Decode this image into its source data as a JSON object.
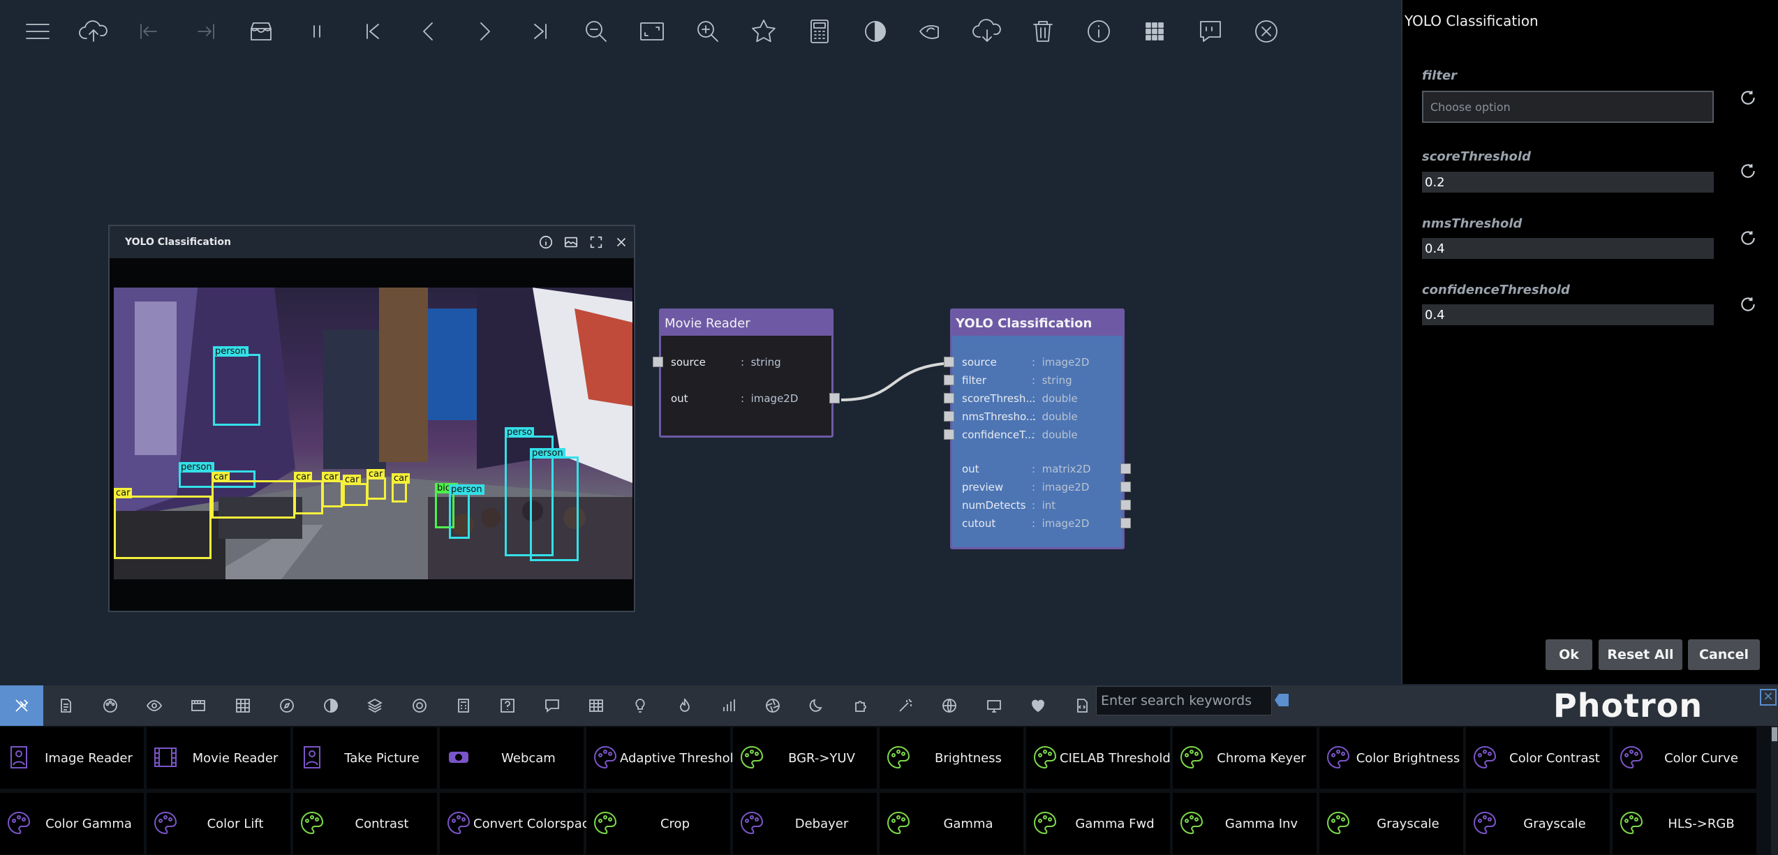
{
  "toolbar": [
    "menu-icon",
    "cloud-upload-icon",
    "step-back-icon",
    "step-forward-icon",
    "store-icon",
    "pause-icon",
    "skip-first-icon",
    "prev-icon",
    "next-icon",
    "skip-last-icon",
    "zoom-out-icon",
    "fit-screen-icon",
    "zoom-in-icon",
    "star-icon",
    "calculator-icon",
    "contrast-icon",
    "nvidia-icon",
    "cloud-download-icon",
    "trash-icon",
    "info-icon",
    "apps-grid-icon",
    "comment-icon",
    "close-circle-icon"
  ],
  "preview": {
    "title": "YOLO Classification",
    "detections": [
      {
        "label": "person",
        "color": "#34e0e8"
      },
      {
        "label": "person",
        "color": "#34e0e8"
      },
      {
        "label": "car",
        "color": "#f5f03a"
      },
      {
        "label": "car",
        "color": "#f5f03a"
      },
      {
        "label": "car",
        "color": "#f5f03a"
      },
      {
        "label": "car",
        "color": "#f5f03a"
      },
      {
        "label": "car",
        "color": "#f5f03a"
      },
      {
        "label": "car",
        "color": "#f5f03a"
      },
      {
        "label": "car",
        "color": "#f5f03a"
      },
      {
        "label": "bicy",
        "color": "#4ef04a"
      },
      {
        "label": "person",
        "color": "#34e0e8"
      },
      {
        "label": "perso",
        "color": "#34e0e8"
      },
      {
        "label": "person",
        "color": "#34e0e8"
      }
    ]
  },
  "movie_reader": {
    "title": "Movie Reader",
    "ports": [
      {
        "name": "source",
        "type": "string"
      },
      {
        "name": "out",
        "type": "image2D"
      }
    ]
  },
  "yolo_node": {
    "title": "YOLO Classification",
    "inputs": [
      {
        "name": "source",
        "type": "image2D"
      },
      {
        "name": "filter",
        "type": "string"
      },
      {
        "name": "scoreThresh...",
        "type": "double"
      },
      {
        "name": "nmsThresho...",
        "type": "double"
      },
      {
        "name": "confidenceT...",
        "type": "double"
      }
    ],
    "outputs": [
      {
        "name": "out",
        "type": "matrix2D"
      },
      {
        "name": "preview",
        "type": "image2D"
      },
      {
        "name": "numDetects",
        "type": "int"
      },
      {
        "name": "cutout",
        "type": "image2D"
      }
    ]
  },
  "panel": {
    "title": "YOLO Classification",
    "filter_label": "filter",
    "filter_placeholder": "Choose option",
    "score_label": "scoreThreshold",
    "score_value": "0.2",
    "nms_label": "nmsThreshold",
    "nms_value": "0.4",
    "conf_label": "confidenceThreshold",
    "conf_value": "0.4",
    "ok": "Ok",
    "reset": "Reset All",
    "cancel": "Cancel"
  },
  "bottom": {
    "search_placeholder": "Enter search keywords",
    "logo": "Photron"
  },
  "palette": [
    {
      "label": "Image Reader",
      "icon": "image-icon",
      "color": "#7a55c8"
    },
    {
      "label": "Movie Reader",
      "icon": "film-icon",
      "color": "#7a55c8"
    },
    {
      "label": "Take Picture",
      "icon": "image-icon",
      "color": "#7a55c8"
    },
    {
      "label": "Webcam",
      "icon": "webcam-icon",
      "color": "#7a55c8"
    },
    {
      "label": "Adaptive Threshold",
      "icon": "palette-icon",
      "color": "#7a55c8"
    },
    {
      "label": "BGR->YUV",
      "icon": "palette-icon",
      "color": "#7dd94a"
    },
    {
      "label": "Brightness",
      "icon": "palette-icon",
      "color": "#7dd94a"
    },
    {
      "label": "CIELAB Threshold",
      "icon": "palette-icon",
      "color": "#7dd94a"
    },
    {
      "label": "Chroma Keyer",
      "icon": "palette-icon",
      "color": "#7dd94a"
    },
    {
      "label": "Color Brightness",
      "icon": "palette-icon",
      "color": "#7a55c8"
    },
    {
      "label": "Color Contrast",
      "icon": "palette-icon",
      "color": "#7a55c8"
    },
    {
      "label": "Color Curve",
      "icon": "palette-icon",
      "color": "#7a55c8"
    },
    {
      "label": "Color Gamma",
      "icon": "palette-icon",
      "color": "#7a55c8"
    },
    {
      "label": "Color Lift",
      "icon": "palette-icon",
      "color": "#7a55c8"
    },
    {
      "label": "Contrast",
      "icon": "palette-icon",
      "color": "#7dd94a"
    },
    {
      "label": "Convert Colorspace",
      "icon": "palette-icon",
      "color": "#7a55c8"
    },
    {
      "label": "Crop",
      "icon": "palette-icon",
      "color": "#7dd94a"
    },
    {
      "label": "Debayer",
      "icon": "palette-icon",
      "color": "#7a55c8"
    },
    {
      "label": "Gamma",
      "icon": "palette-icon",
      "color": "#7dd94a"
    },
    {
      "label": "Gamma Fwd",
      "icon": "palette-icon",
      "color": "#7dd94a"
    },
    {
      "label": "Gamma Inv",
      "icon": "palette-icon",
      "color": "#7dd94a"
    },
    {
      "label": "Grayscale",
      "icon": "palette-icon",
      "color": "#7dd94a"
    },
    {
      "label": "Grayscale",
      "icon": "palette-icon",
      "color": "#7a55c8"
    },
    {
      "label": "HLS->RGB",
      "icon": "palette-icon",
      "color": "#7dd94a"
    }
  ]
}
